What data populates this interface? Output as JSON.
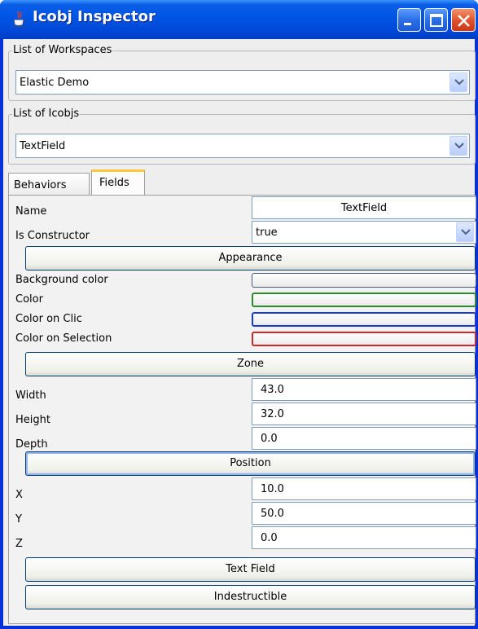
{
  "window": {
    "title": "Icobj Inspector",
    "controls": [
      "minimize-icon",
      "maximize-icon",
      "close-icon"
    ]
  },
  "workspaces": {
    "group_label": "List of Workspaces",
    "selected": "Elastic Demo"
  },
  "icobjs": {
    "group_label": "List of Icobjs",
    "selected": "TextField"
  },
  "tabs": [
    {
      "label": "Behaviors",
      "active": false
    },
    {
      "label": "Fields",
      "active": true
    }
  ],
  "fields": {
    "name_label": "Name",
    "name_value": "TextField",
    "constructor_label": "Is Constructor",
    "constructor_value": "true",
    "appearance_button": "Appearance",
    "background_color_label": "Background color",
    "color_label": "Color",
    "color_on_clic_label": "Color on Clic",
    "color_on_selection_label": "Color on Selection",
    "colors": {
      "background": "#ffffff",
      "color_border": "#2e8b2e",
      "clic_border": "#1a3ad8",
      "selection_border": "#d0282a"
    },
    "zone_button": "Zone",
    "width_label": "Width",
    "width_value": "43.0",
    "height_label": "Height",
    "height_value": "32.0",
    "depth_label": "Depth",
    "depth_value": "0.0",
    "position_button": "Position",
    "x_label": "X",
    "x_value": "10.0",
    "y_label": "Y",
    "y_value": "50.0",
    "z_label": "Z",
    "z_value": "0.0",
    "text_field_button": "Text Field",
    "indestructible_button": "Indestructible"
  }
}
